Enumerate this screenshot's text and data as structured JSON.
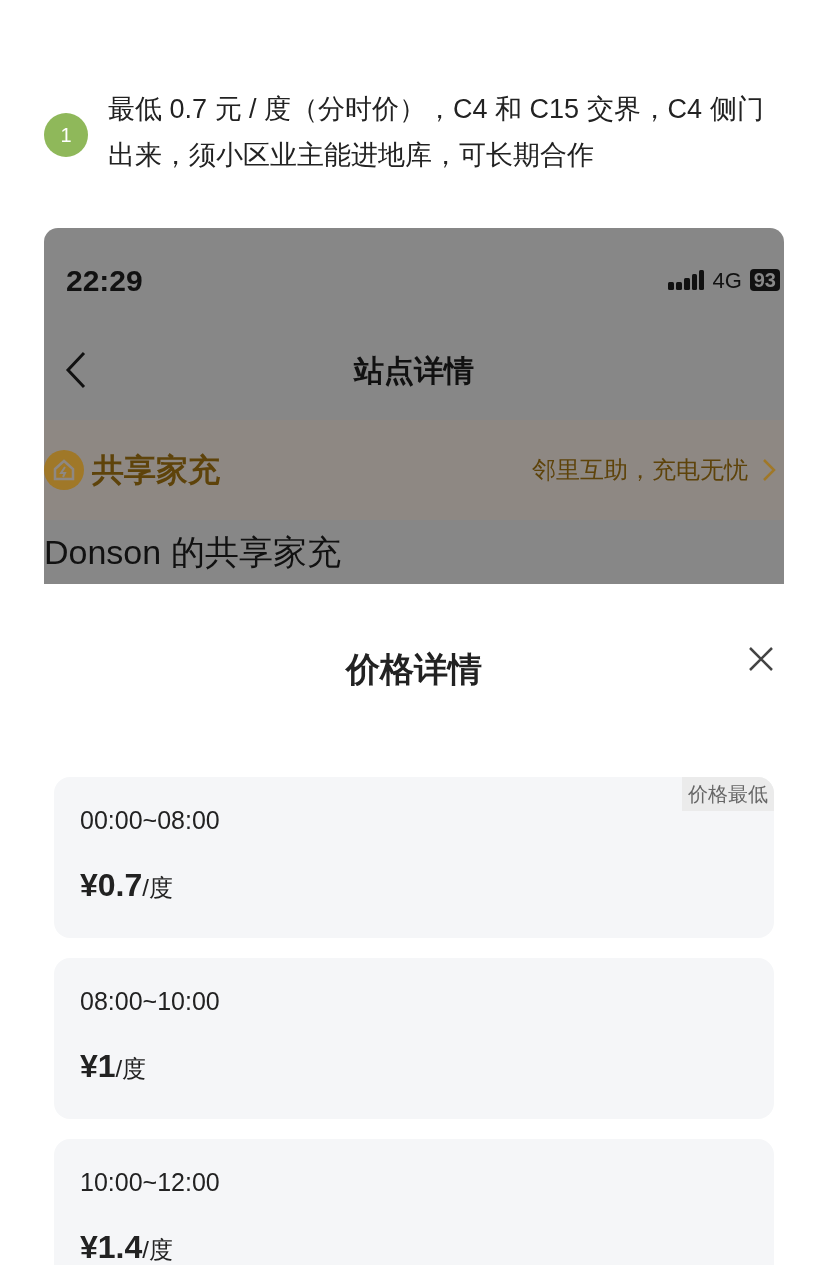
{
  "note": {
    "number": "1",
    "text": "最低 0.7 元 / 度（分时价），C4 和 C15 交界，C4 侧门出来，须小区业主能进地库，可长期合作"
  },
  "status_bar": {
    "time": "22:29",
    "network": "4G",
    "battery": "93"
  },
  "nav": {
    "title": "站点详情"
  },
  "banner": {
    "brand": "共享家充",
    "slogan": "邻里互助，充电无忧"
  },
  "station": {
    "name": "Donson 的共享家充"
  },
  "sheet": {
    "title": "价格详情",
    "periods": [
      {
        "time": "00:00~08:00",
        "amount": "¥0.7",
        "unit": "/度",
        "badge": "价格最低"
      },
      {
        "time": "08:00~10:00",
        "amount": "¥1",
        "unit": "/度"
      },
      {
        "time": "10:00~12:00",
        "amount": "¥1.4",
        "unit": "/度"
      }
    ]
  }
}
